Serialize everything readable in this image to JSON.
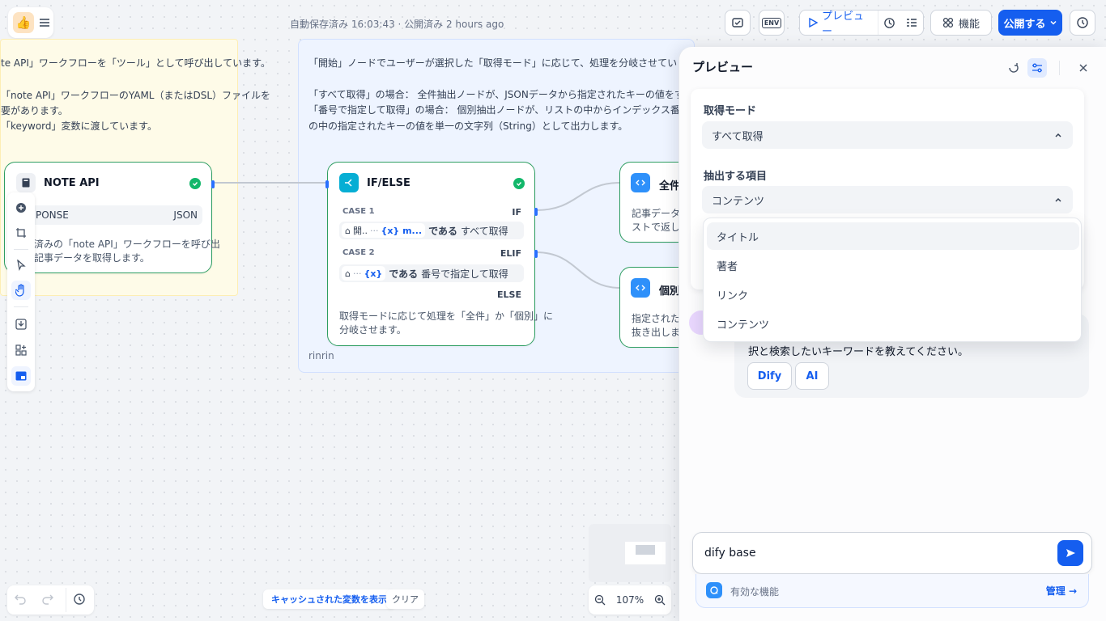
{
  "topbar": {
    "status": "自動保存済み 16:03:43 · 公開済み 2 hours ago",
    "env_label": "ENV",
    "preview_label": "プレビュー",
    "features_label": "機能",
    "publish_label": "公開する"
  },
  "note_left": {
    "lines": [
      "te API」ワークフローを「ツール」として呼び出しています。",
      "「note API」ワークフローのYAML（またはDSL）ファイルを",
      "要があります。",
      "「keyword」変数に渡しています。"
    ]
  },
  "note_right": {
    "lines": [
      "「開始」ノードでユーザーが選択した「取得モード」に応じて、処理を分岐させています。",
      "「すべて取得」の場合： 全件抽出ノードが、JSONデータから指定されたキーの値をすべて抽出し",
      "「番号で指定して取得」の場合： 個別抽出ノードが、リストの中からインデックス番号で指定さ",
      "の中の指定されたキーの値を単一の文字列（String）として出力します。"
    ],
    "author": "rinrin"
  },
  "node_note_api": {
    "title": "NOTE API",
    "var_name": "PONSE",
    "var_type": "JSON",
    "desc": [
      "済みの「note API」ワークフローを呼び出",
      "記事データを取得します。"
    ]
  },
  "node_ifelse": {
    "title": "IF/ELSE",
    "case1_label": "CASE 1",
    "case1_branch": "IF",
    "case1_chip": "開..",
    "case1_dots": "···",
    "case1_var": "{x} m...",
    "case1_op": "である",
    "case1_value": "すべて取得",
    "case2_label": "CASE 2",
    "case2_branch": "ELIF",
    "case2_dots": "···",
    "case2_var": "{x}",
    "case2_op": "である",
    "case2_value": "番号で指定して取得",
    "else_label": "ELSE",
    "desc": [
      "取得モードに応じて処理を「全件」か「個別」に",
      "分岐させます。"
    ]
  },
  "node_all": {
    "title": "全件",
    "desc": [
      "記事データか",
      "ストで返しま"
    ]
  },
  "node_single": {
    "title": "個別",
    "desc": [
      "指定された番",
      "抜き出しま"
    ]
  },
  "bottom": {
    "cache_label": "キャッシュされた変数を表示",
    "clear_label": "クリア",
    "zoom": "107%"
  },
  "preview": {
    "title": "プレビュー",
    "field1_label": "取得モード",
    "field1_value": "すべて取得",
    "field2_label": "抽出する項目",
    "field2_value": "コンテンツ",
    "options": [
      "タイトル",
      "著者",
      "リンク",
      "コンテンツ"
    ],
    "chat_text": "択と検索したいキーワードを教えてください。",
    "suggest1": "Dify",
    "suggest2": "AI",
    "input_value": "dify base",
    "features_text": "有効な機能",
    "manage_label": "管理 →"
  },
  "colors": {
    "accent": "#155eef",
    "node_border": "#2e9e62",
    "success": "#12b76a",
    "note_yellow": "#fefbe8",
    "note_blue": "#eef4ff"
  },
  "icons": [
    "thumbs-up-logo-icon",
    "menu-icon",
    "checklist-icon",
    "env-icon",
    "play-icon",
    "debug-clock-icon",
    "list-check-icon",
    "apps-icon",
    "chevron-down-icon",
    "history-icon",
    "book-icon",
    "branch-icon",
    "code-icon",
    "check-icon",
    "plus-circle-icon",
    "note-add-icon",
    "pointer-icon",
    "hand-icon",
    "import-icon",
    "blocks-icon",
    "minimap-icon",
    "undo-icon",
    "redo-icon",
    "refresh-icon",
    "settings-sliders-icon",
    "close-icon",
    "chevron-up-icon",
    "send-icon",
    "feature-icon"
  ]
}
